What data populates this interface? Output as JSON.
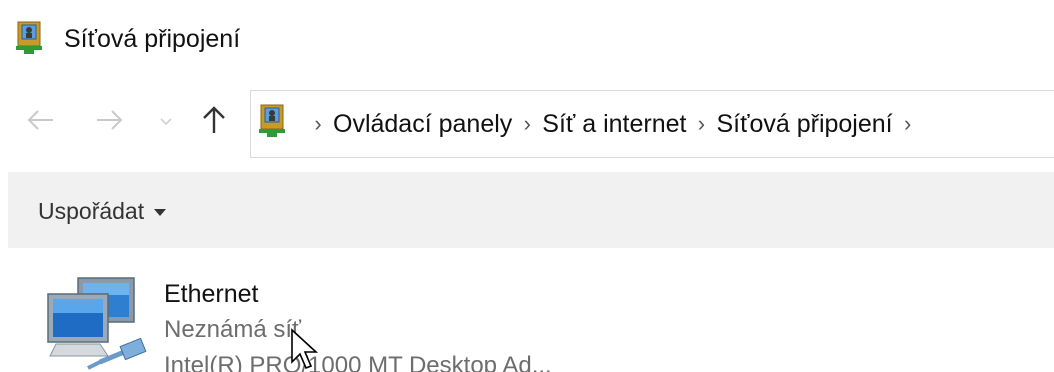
{
  "window": {
    "title": "Síťová připojení",
    "title_icon": "network-connections-icon"
  },
  "navigation": {
    "back_icon": "back-arrow-icon",
    "forward_icon": "forward-arrow-icon",
    "recent_icon": "recent-locations-chevron-icon",
    "up_icon": "up-arrow-icon"
  },
  "address_bar": {
    "location_icon": "control-panel-icon",
    "separator": "›",
    "breadcrumbs": [
      "Ovládací panely",
      "Síť a internet",
      "Síťová připojení"
    ]
  },
  "command_bar": {
    "organize_label": "Uspořádat"
  },
  "connections": [
    {
      "name": "Ethernet",
      "status": "Neznámá síť",
      "device": "Intel(R) PRO/1000 MT Desktop Ad...",
      "icon": "ethernet-adapter-icon"
    }
  ],
  "colors": {
    "command_bar_bg": "#f1f1f1",
    "secondary_text": "#6d6d6d",
    "address_border": "#d9d9d9"
  }
}
